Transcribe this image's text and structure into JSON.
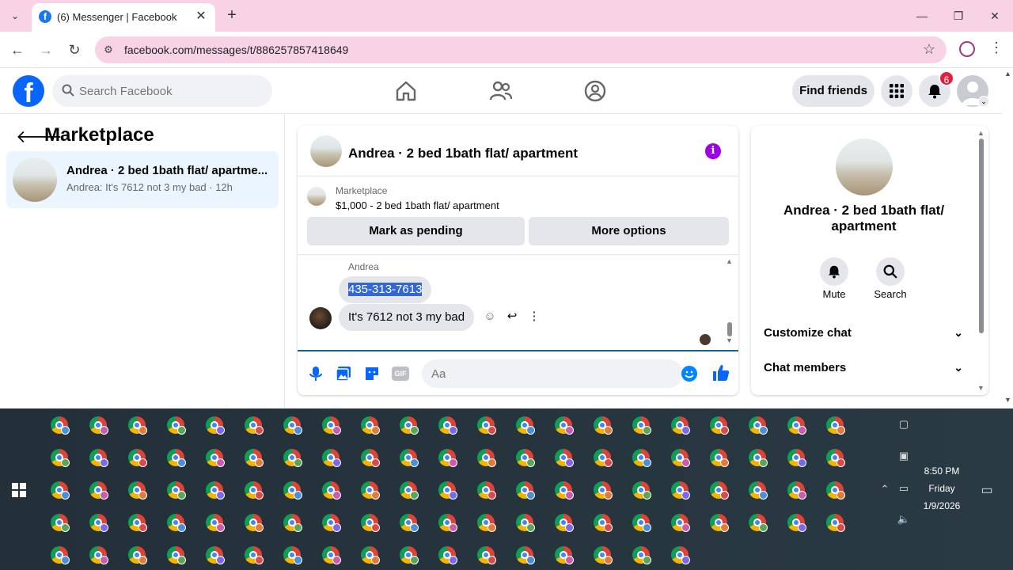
{
  "browser": {
    "tab_title": "(6) Messenger | Facebook",
    "tab_favicon_letter": "f",
    "url": "facebook.com/messages/t/886257857418649"
  },
  "fb": {
    "logo_letter": "f",
    "search_placeholder": "Search Facebook",
    "find_friends": "Find friends",
    "notification_count": "6"
  },
  "left": {
    "title": "Marketplace",
    "conversation": {
      "title": "Andrea · 2 bed 1bath flat/ apartme...",
      "preview": "Andrea: It's 7612 not 3 my bad · 12h"
    }
  },
  "chat": {
    "title": "Andrea · 2 bed 1bath flat/ apartment",
    "marketplace_label": "Marketplace",
    "listing": "$1,000 - 2 bed 1bath flat/ apartment",
    "mark_pending": "Mark as pending",
    "more_options": "More options",
    "sender": "Andrea",
    "message1": "435-313-7613",
    "message2": "It's 7612 not 3 my bad",
    "input_placeholder": "Aa"
  },
  "right": {
    "name": "Andrea · 2 bed 1bath flat/ apartment",
    "mute": "Mute",
    "search": "Search",
    "customize": "Customize chat",
    "members": "Chat members"
  },
  "taskbar": {
    "time": "8:50 PM",
    "day": "Friday",
    "date": "1/9/2026"
  },
  "colors": {
    "fb_blue": "#0866ff",
    "selected_conversation": "#ebf5ff",
    "info_purple": "#9b00e8",
    "tab_strip": "#f7d3e5",
    "notification_red": "#e41e3f"
  }
}
